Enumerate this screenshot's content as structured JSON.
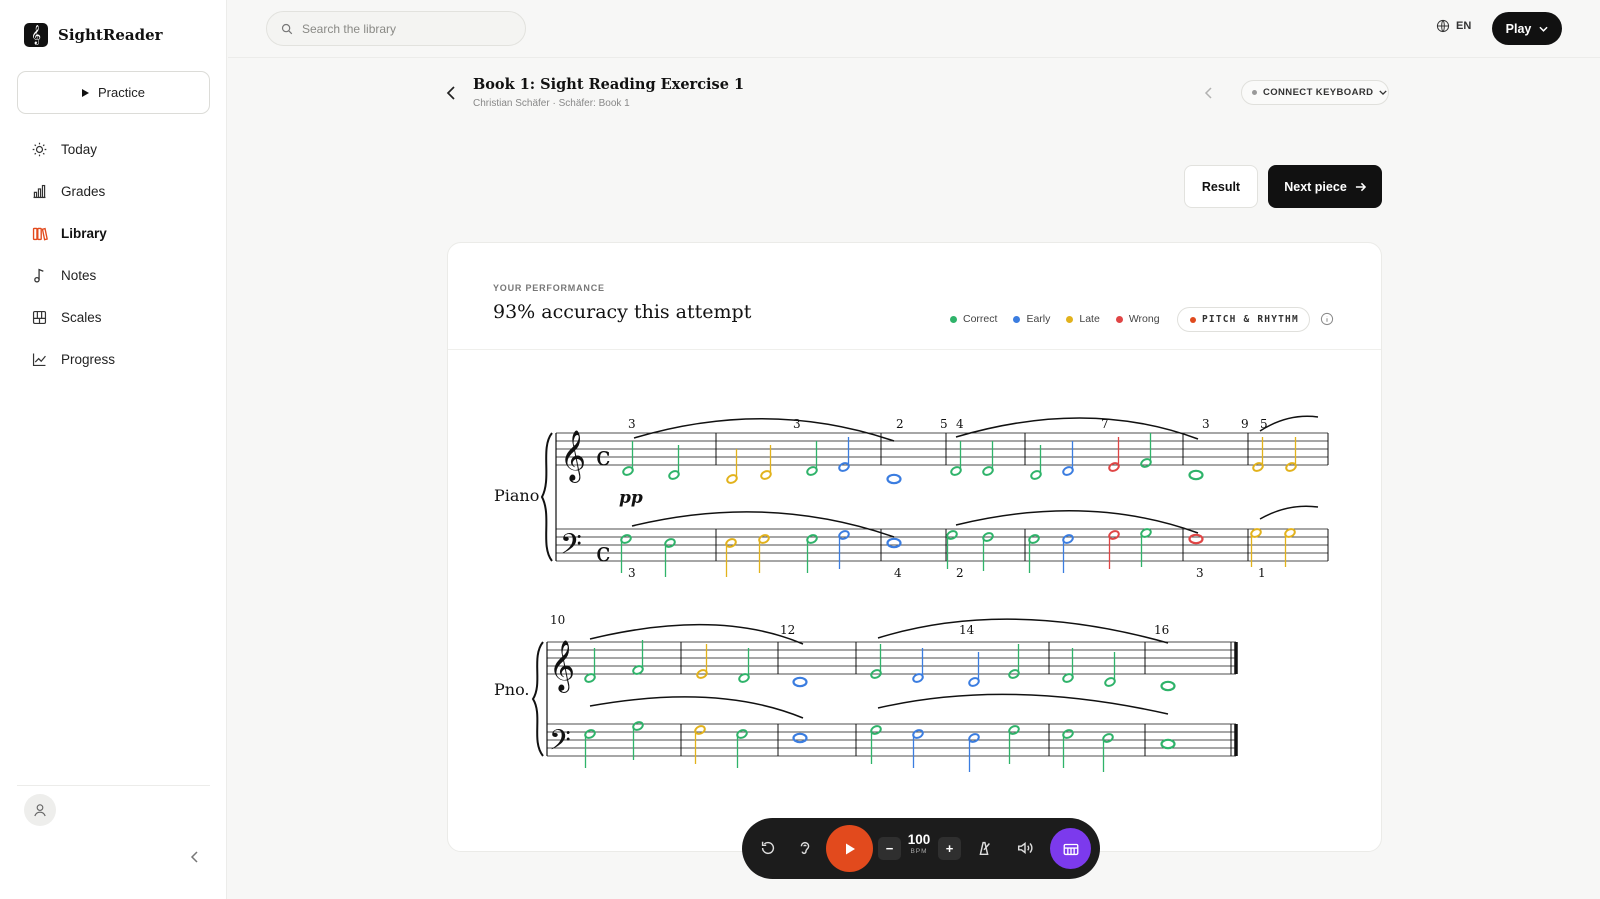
{
  "app": {
    "name": "SightReader"
  },
  "sidebar": {
    "practice_label": "Practice",
    "items": [
      {
        "label": "Today",
        "icon": "sun-icon"
      },
      {
        "label": "Grades",
        "icon": "bar-chart-icon"
      },
      {
        "label": "Library",
        "icon": "books-icon",
        "active": true
      },
      {
        "label": "Notes",
        "icon": "music-note-icon"
      },
      {
        "label": "Scales",
        "icon": "piano-keys-icon"
      },
      {
        "label": "Progress",
        "icon": "line-chart-icon"
      }
    ]
  },
  "topbar": {
    "search_placeholder": "Search the library",
    "language": "EN",
    "play_label": "Play"
  },
  "piece": {
    "title": "Book 1: Sight Reading Exercise 1",
    "subtitle": "Christian Schäfer · Schäfer: Book 1",
    "connect_label": "CONNECT KEYBOARD"
  },
  "actions": {
    "result_label": "Result",
    "next_label": "Next piece"
  },
  "performance": {
    "eyebrow": "YOUR PERFORMANCE",
    "title": "93% accuracy this attempt",
    "legend": [
      {
        "label": "Correct",
        "color": "#2fb36a"
      },
      {
        "label": "Early",
        "color": "#3b7de0"
      },
      {
        "label": "Late",
        "color": "#e2b21c"
      },
      {
        "label": "Wrong",
        "color": "#e04545"
      }
    ],
    "mode_label": "PITCH & RHYTHM"
  },
  "score": {
    "system1_instrument": "Piano",
    "system2_instrument": "Pno.",
    "dynamic": "pp",
    "measure_numbers": [
      "10",
      "12",
      "14",
      "16"
    ],
    "time_signature": "c",
    "fingerings_treble": [
      "3",
      "3",
      "2",
      "5",
      "4",
      "7",
      "3",
      "9",
      "5"
    ],
    "fingerings_bass": [
      "3",
      "4",
      "2",
      "3",
      "1"
    ]
  },
  "playback": {
    "bpm": "100",
    "bpm_unit": "BPM",
    "minus": "−",
    "plus": "+"
  },
  "colors": {
    "correct": "#2fb36a",
    "early": "#3b7de0",
    "late": "#e2b21c",
    "wrong": "#e04545",
    "accent": "#e24a1d",
    "piano": "#7c3aed"
  }
}
